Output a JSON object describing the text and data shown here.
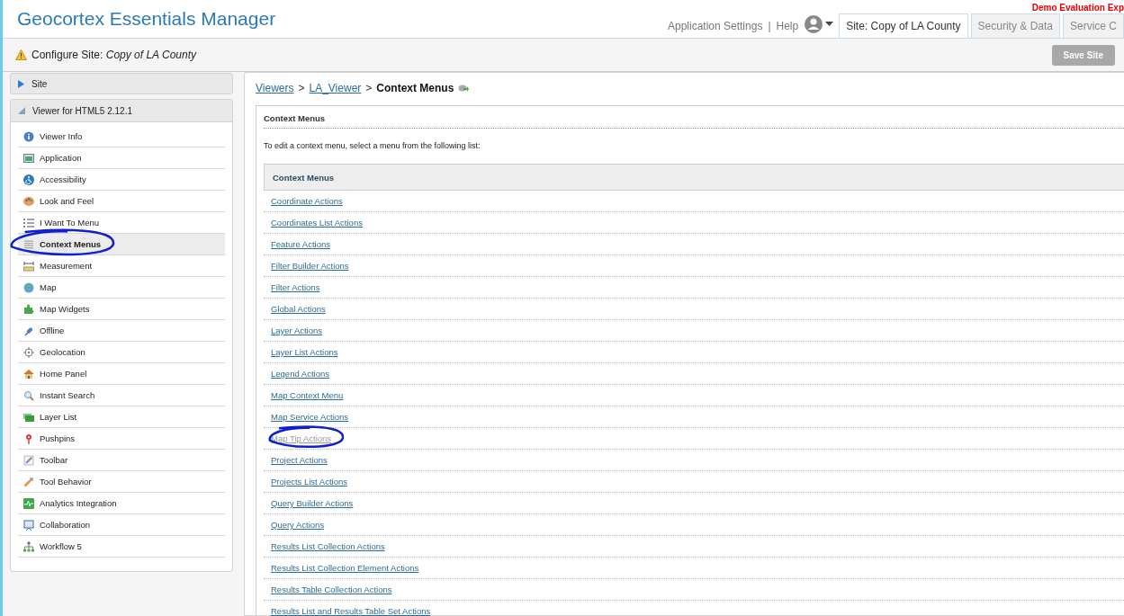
{
  "header": {
    "title": "Geocortex Essentials Manager",
    "notice": "Demo Evaluation Exp",
    "links": [
      "Application Settings",
      "Help"
    ],
    "link_separator": "|",
    "tabs": [
      {
        "label": "Site: Copy of LA County",
        "selected": true
      },
      {
        "label": "Security & Data",
        "selected": false
      },
      {
        "label": "Service C",
        "selected": false
      }
    ]
  },
  "configure_bar": {
    "label": "Configure Site:",
    "site": "Copy of LA County",
    "save_button": {
      "label": "Save Site",
      "disabled": true
    }
  },
  "sidebar": {
    "sections": [
      {
        "title": "Site",
        "expanded": false
      },
      {
        "title": "Viewer for HTML5 2.12.1",
        "expanded": true,
        "items": [
          {
            "label": "Viewer Info",
            "selected": false,
            "circled": false
          },
          {
            "label": "Application",
            "selected": false,
            "circled": false
          },
          {
            "label": "Accessibility",
            "selected": false,
            "circled": false
          },
          {
            "label": "Look and Feel",
            "selected": false,
            "circled": false
          },
          {
            "label": "I Want To Menu",
            "selected": false,
            "circled": false
          },
          {
            "label": "Context Menus",
            "selected": true,
            "circled": true
          },
          {
            "label": "Measurement",
            "selected": false,
            "circled": false
          },
          {
            "label": "Map",
            "selected": false,
            "circled": false
          },
          {
            "label": "Map Widgets",
            "selected": false,
            "circled": false
          },
          {
            "label": "Offline",
            "selected": false,
            "circled": false
          },
          {
            "label": "Geolocation",
            "selected": false,
            "circled": false
          },
          {
            "label": "Home Panel",
            "selected": false,
            "circled": false
          },
          {
            "label": "Instant Search",
            "selected": false,
            "circled": false
          },
          {
            "label": "Layer List",
            "selected": false,
            "circled": false
          },
          {
            "label": "Pushpins",
            "selected": false,
            "circled": false
          },
          {
            "label": "Toolbar",
            "selected": false,
            "circled": false
          },
          {
            "label": "Tool Behavior",
            "selected": false,
            "circled": false
          },
          {
            "label": "Analytics Integration",
            "selected": false,
            "circled": false
          },
          {
            "label": "Collaboration",
            "selected": false,
            "circled": false
          },
          {
            "label": "Workflow 5",
            "selected": false,
            "circled": false
          }
        ]
      }
    ]
  },
  "breadcrumb": {
    "links": [
      "Viewers",
      "LA_Viewer"
    ],
    "separator": ">",
    "current": "Context Menus"
  },
  "panel": {
    "title": "Context Menus",
    "instructions": "To edit a context menu, select a menu from the following list:",
    "table": {
      "column": "Context Menus",
      "rows": [
        {
          "label": "Coordinate Actions",
          "dimmed": false,
          "circled": false
        },
        {
          "label": "Coordinates List Actions",
          "dimmed": false,
          "circled": false
        },
        {
          "label": "Feature Actions",
          "dimmed": false,
          "circled": false
        },
        {
          "label": "Filter Builder Actions",
          "dimmed": false,
          "circled": false
        },
        {
          "label": "Filter Actions",
          "dimmed": false,
          "circled": false
        },
        {
          "label": "Global Actions",
          "dimmed": false,
          "circled": false
        },
        {
          "label": "Layer Actions",
          "dimmed": false,
          "circled": false
        },
        {
          "label": "Layer List Actions",
          "dimmed": false,
          "circled": false
        },
        {
          "label": "Legend Actions",
          "dimmed": false,
          "circled": false
        },
        {
          "label": "Map Context Menu",
          "dimmed": false,
          "circled": false
        },
        {
          "label": "Map Service Actions",
          "dimmed": false,
          "circled": false
        },
        {
          "label": "Map Tip Actions",
          "dimmed": true,
          "circled": true
        },
        {
          "label": "Project Actions",
          "dimmed": false,
          "circled": false
        },
        {
          "label": "Projects List Actions",
          "dimmed": false,
          "circled": false
        },
        {
          "label": "Query Builder Actions",
          "dimmed": false,
          "circled": false
        },
        {
          "label": "Query Actions",
          "dimmed": false,
          "circled": false
        },
        {
          "label": "Results List Collection Actions",
          "dimmed": false,
          "circled": false
        },
        {
          "label": "Results List Collection Element Actions",
          "dimmed": false,
          "circled": false
        },
        {
          "label": "Results Table Collection Actions",
          "dimmed": false,
          "circled": false
        },
        {
          "label": "Results List and Results Table Set Actions",
          "dimmed": false,
          "circled": false
        }
      ]
    }
  }
}
